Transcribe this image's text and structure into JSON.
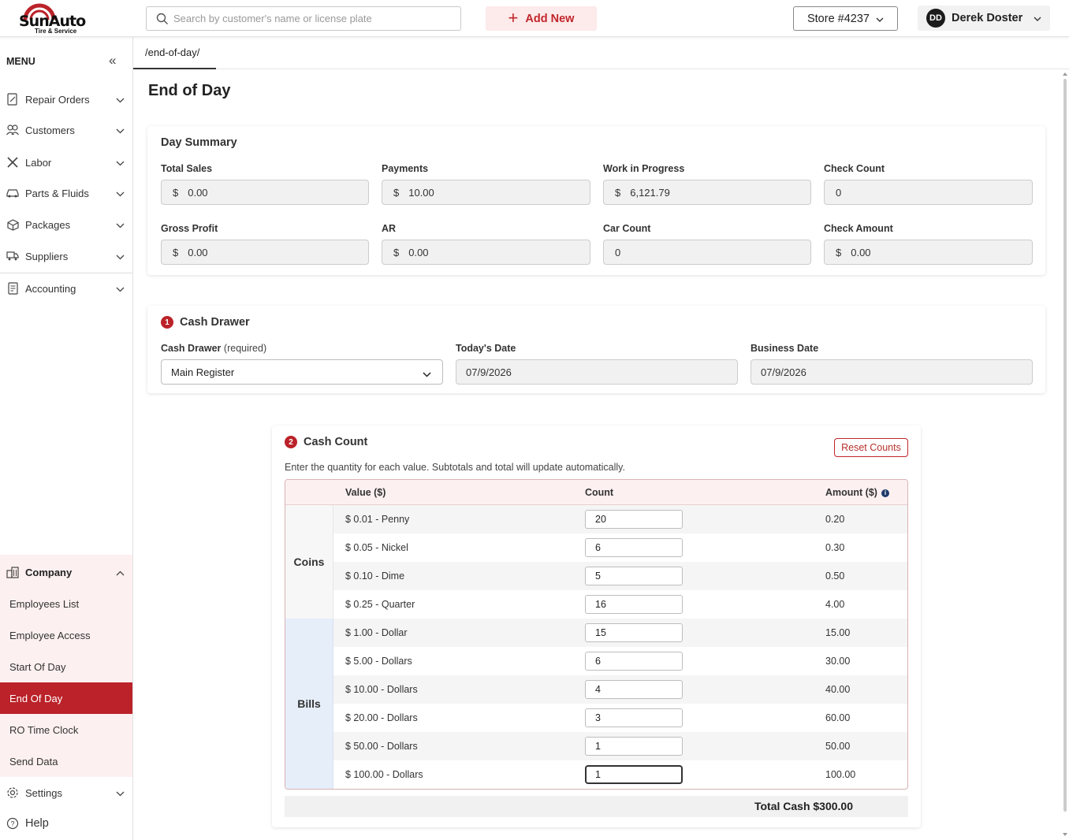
{
  "brand": {
    "name_part1": "Sun",
    "name_part2": "Auto",
    "tagline": "Tire & Service",
    "accent": "#bb2229"
  },
  "search": {
    "placeholder": "Search by customer's name or license plate",
    "icon": "search-icon"
  },
  "header": {
    "add_new_label": "Add New",
    "store_label": "Store #4237",
    "user_initials": "DD",
    "user_name": "Derek Doster"
  },
  "sidebar": {
    "menu_label": "MENU",
    "items": [
      {
        "label": "Repair Orders",
        "icon": "document-edit-icon"
      },
      {
        "label": "Customers",
        "icon": "users-icon"
      },
      {
        "label": "Labor",
        "icon": "tools-icon"
      },
      {
        "label": "Parts & Fluids",
        "icon": "car-icon"
      },
      {
        "label": "Packages",
        "icon": "box-icon"
      },
      {
        "label": "Suppliers",
        "icon": "truck-icon"
      },
      {
        "label": "Accounting",
        "icon": "ledger-icon"
      }
    ],
    "company": {
      "label": "Company",
      "icon": "building-icon",
      "subitems": [
        "Employees List",
        "Employee Access",
        "Start Of Day",
        "End Of Day",
        "RO Time Clock",
        "Send Data"
      ],
      "active": "End Of Day"
    },
    "settings_label": "Settings",
    "help_label": "Help"
  },
  "tab": {
    "path": "/end-of-day/"
  },
  "page": {
    "title": "End of Day"
  },
  "day_summary": {
    "title": "Day Summary",
    "currency": "$",
    "fields": {
      "total_sales": {
        "label": "Total Sales",
        "value": "0.00"
      },
      "payments": {
        "label": "Payments",
        "value": "10.00"
      },
      "work_in_progress": {
        "label": "Work in Progress",
        "value": "6,121.79"
      },
      "check_count": {
        "label": "Check Count",
        "value": "0"
      },
      "gross_profit": {
        "label": "Gross Profit",
        "value": "0.00"
      },
      "ar": {
        "label": "AR",
        "value": "0.00"
      },
      "car_count": {
        "label": "Car Count",
        "value": "0"
      },
      "check_amount": {
        "label": "Check Amount",
        "value": "0.00"
      }
    }
  },
  "cash_drawer": {
    "step": "1",
    "title": "Cash Drawer",
    "drawer_label": "Cash Drawer",
    "drawer_required": "(required)",
    "drawer_value": "Main Register",
    "todays_date_label": "Today's Date",
    "todays_date": "07/9/2026",
    "business_date_label": "Business Date",
    "business_date": "07/9/2026"
  },
  "cash_count": {
    "step": "2",
    "title": "Cash Count",
    "reset_label": "Reset Counts",
    "hint": "Enter the quantity for each value. Subtotals and total will update automatically.",
    "headers": {
      "value": "Value ($)",
      "count": "Count",
      "amount": "Amount ($)"
    },
    "groups": {
      "coins": "Coins",
      "bills": "Bills"
    },
    "rows": [
      {
        "value": "$ 0.01 - Penny",
        "count": "20",
        "amount": "0.20"
      },
      {
        "value": "$ 0.05 - Nickel",
        "count": "6",
        "amount": "0.30"
      },
      {
        "value": "$ 0.10 - Dime",
        "count": "5",
        "amount": "0.50"
      },
      {
        "value": "$ 0.25 - Quarter",
        "count": "16",
        "amount": "4.00"
      },
      {
        "value": "$ 1.00 - Dollar",
        "count": "15",
        "amount": "15.00"
      },
      {
        "value": "$ 5.00 - Dollars",
        "count": "6",
        "amount": "30.00"
      },
      {
        "value": "$ 10.00 - Dollars",
        "count": "4",
        "amount": "40.00"
      },
      {
        "value": "$ 20.00 - Dollars",
        "count": "3",
        "amount": "60.00"
      },
      {
        "value": "$ 50.00 - Dollars",
        "count": "1",
        "amount": "50.00"
      },
      {
        "value": "$ 100.00 - Dollars",
        "count": "1",
        "amount": "100.00"
      }
    ],
    "total_label": "Total Cash $300.00"
  }
}
